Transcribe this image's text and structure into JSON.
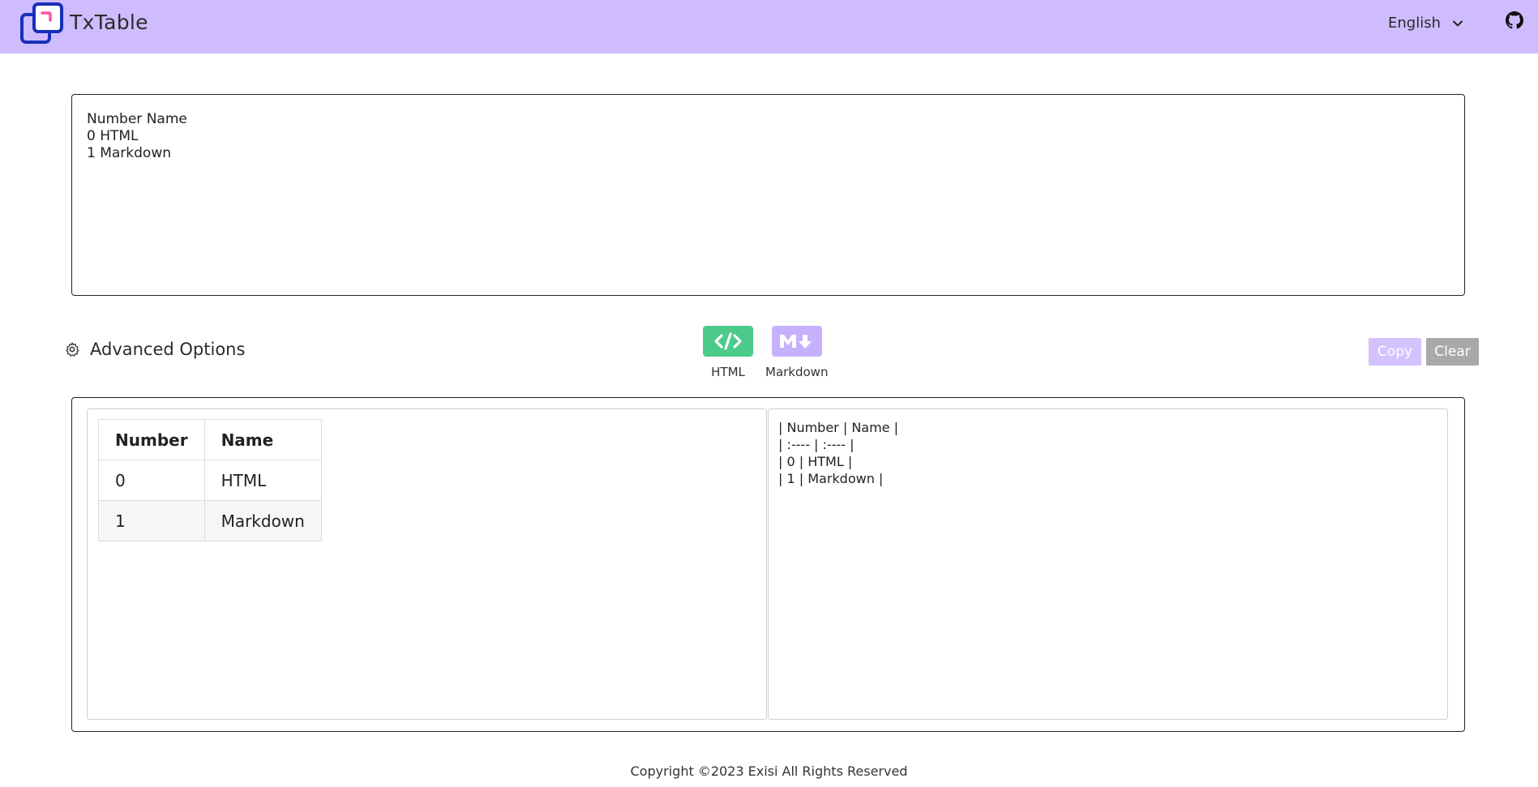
{
  "header": {
    "brand": "TxTable",
    "language": "English",
    "icons": [
      "txtable-logo-icon",
      "chevron-down-icon",
      "github-icon"
    ]
  },
  "input": {
    "text": "Number Name\n0 HTML\n1 Markdown"
  },
  "options": {
    "advanced_label": "Advanced Options",
    "icon": "gear-icon"
  },
  "formats": {
    "html_label": "HTML",
    "markdown_label": "Markdown"
  },
  "actions": {
    "copy_label": "Copy",
    "clear_label": "Clear"
  },
  "preview_table": {
    "headers": [
      "Number",
      "Name"
    ],
    "rows": [
      [
        "0",
        "HTML"
      ],
      [
        "1",
        "Markdown"
      ]
    ]
  },
  "markdown_output": {
    "text": "| Number | Name |\n| :---- | :---- |\n| 0 | HTML |\n| 1 | Markdown |"
  },
  "footer": {
    "copyright": "Copyright ©2023 Exisi All Rights Reserved"
  },
  "colors": {
    "header_bg": "#cfbcff",
    "html_icon_bg": "#4cca8a",
    "markdown_icon_bg": "#c6b1ff",
    "copy_bg": "#d4c2ff",
    "clear_bg": "#a9a9a9",
    "logo_blue": "#1a2fb8",
    "logo_pink": "#ff4fa3"
  }
}
